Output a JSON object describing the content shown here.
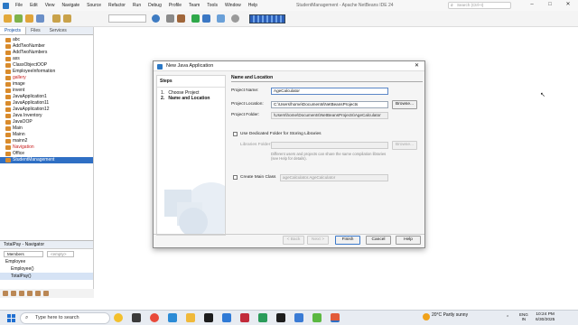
{
  "menubar": {
    "items": [
      "File",
      "Edit",
      "View",
      "Navigate",
      "Source",
      "Refactor",
      "Run",
      "Debug",
      "Profile",
      "Team",
      "Tools",
      "Window",
      "Help"
    ],
    "window_title": "StudentManagement - Apache NetBeans IDE 24",
    "search_placeholder": "Search (Ctrl+I)"
  },
  "left_tabs": [
    "Projects",
    "Files",
    "Services"
  ],
  "projects": [
    {
      "name": "abc",
      "red": false
    },
    {
      "name": "AddTwoNumber",
      "red": false
    },
    {
      "name": "AddTwoNumbers",
      "red": false
    },
    {
      "name": "ass",
      "red": false
    },
    {
      "name": "ClassObjectOOP",
      "red": false
    },
    {
      "name": "EmployeeInformation",
      "red": false
    },
    {
      "name": "gallery",
      "red": true
    },
    {
      "name": "image",
      "red": false
    },
    {
      "name": "invent",
      "red": false
    },
    {
      "name": "JavaApplication1",
      "red": false
    },
    {
      "name": "JavaApplication11",
      "red": false
    },
    {
      "name": "JavaApplication12",
      "red": false
    },
    {
      "name": "Java Inventory",
      "red": false
    },
    {
      "name": "JavaOOP",
      "red": false
    },
    {
      "name": "Main",
      "red": false
    },
    {
      "name": "Mainn",
      "red": false
    },
    {
      "name": "mainn2",
      "red": false
    },
    {
      "name": "Navigation",
      "red": true
    },
    {
      "name": "Office",
      "red": false
    },
    {
      "name": "StudentManagement",
      "red": false,
      "selected": true
    }
  ],
  "navigator": {
    "title": "TotalPay - Navigator",
    "filter_members": "Members",
    "filter_empty": "<empty>",
    "rows": [
      "Employee",
      "Employee()",
      "TotalPay()"
    ]
  },
  "dialog": {
    "title": "New Java Application",
    "steps_header": "Steps",
    "steps": [
      {
        "num": "1.",
        "label": "Choose Project",
        "bold": false
      },
      {
        "num": "2.",
        "label": "Name and Location",
        "bold": true
      }
    ],
    "section_title": "Name and Location",
    "project_name_label": "Project Name:",
    "project_name_value": "AgeCalculator",
    "project_location_label": "Project Location:",
    "project_location_value": "C:\\Users\\home\\Documents\\NetBeansProjects",
    "project_folder_label": "Project Folder:",
    "project_folder_value": "\\Users\\home\\Documents\\NetBeansProjects\\AgeCalculator",
    "browse_label": "Browse...",
    "dedicated_folder_label": "Use Dedicated Folder for Storing Libraries",
    "libraries_folder_label": "Libraries Folder:",
    "libraries_note": "Different users and projects can share the same compilation libraries (see Help for details).",
    "create_main_label": "Create Main Class",
    "main_class_value": "ageCalculator.AgeCalculator",
    "buttons": {
      "back": "< Back",
      "next": "Next >",
      "finish": "Finish",
      "cancel": "Cancel",
      "help": "Help"
    }
  },
  "taskbar": {
    "search_placeholder": "Type here to search",
    "weather_temp": "20°C",
    "weather_text": "Partly sunny",
    "lang_top": "ENG",
    "lang_bottom": "IN",
    "time": "10:24 PM",
    "date": "6/30/2025"
  },
  "colors": {
    "accent": "#2f6fc4",
    "error_red": "#c92020"
  }
}
